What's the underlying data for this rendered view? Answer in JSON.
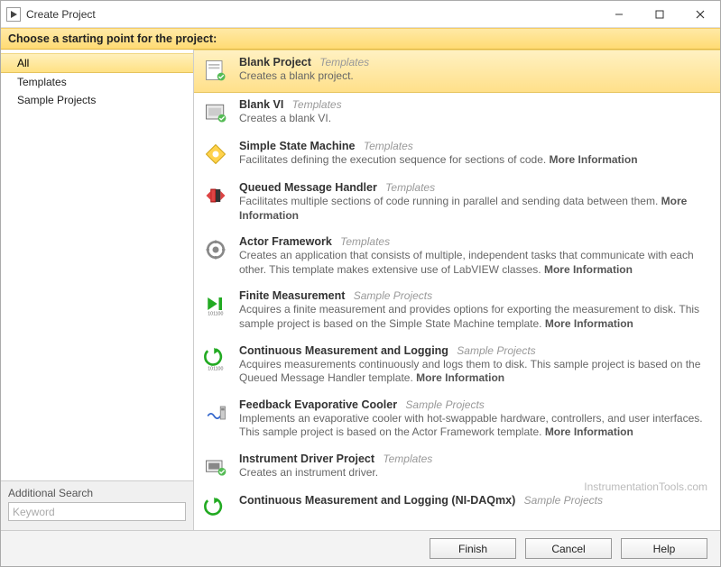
{
  "window": {
    "title": "Create Project",
    "banner": "Choose a starting point for the project:"
  },
  "categories": {
    "items": [
      {
        "label": "All",
        "selected": true
      },
      {
        "label": "Templates",
        "selected": false
      },
      {
        "label": "Sample Projects",
        "selected": false
      }
    ]
  },
  "search": {
    "label": "Additional Search",
    "placeholder": "Keyword",
    "value": ""
  },
  "templates": [
    {
      "icon": "blank-project-icon",
      "title": "Blank Project",
      "category": "Templates",
      "desc": "Creates a blank project.",
      "more": false,
      "selected": true
    },
    {
      "icon": "blank-vi-icon",
      "title": "Blank VI",
      "category": "Templates",
      "desc": "Creates a blank VI.",
      "more": false,
      "selected": false
    },
    {
      "icon": "state-machine-icon",
      "title": "Simple State Machine",
      "category": "Templates",
      "desc": "Facilitates defining the execution sequence for sections of code. ",
      "more": true,
      "selected": false
    },
    {
      "icon": "queued-handler-icon",
      "title": "Queued Message Handler",
      "category": "Templates",
      "desc": "Facilitates multiple sections of code running in parallel and sending data between them. ",
      "more": true,
      "selected": false
    },
    {
      "icon": "actor-framework-icon",
      "title": "Actor Framework",
      "category": "Templates",
      "desc": "Creates an application that consists of multiple, independent tasks that communicate with each other. This template makes extensive use of LabVIEW classes. ",
      "more": true,
      "selected": false
    },
    {
      "icon": "finite-measurement-icon",
      "title": "Finite Measurement",
      "category": "Sample Projects",
      "desc": "Acquires a finite measurement and provides options for exporting the measurement to disk. This sample project is based on the Simple State Machine template. ",
      "more": true,
      "selected": false
    },
    {
      "icon": "continuous-log-icon",
      "title": "Continuous Measurement and Logging",
      "category": "Sample Projects",
      "desc": "Acquires measurements continuously and logs them to disk. This sample project is based on the Queued Message Handler template. ",
      "more": true,
      "selected": false
    },
    {
      "icon": "evaporative-cooler-icon",
      "title": "Feedback Evaporative Cooler",
      "category": "Sample Projects",
      "desc": "Implements an evaporative cooler with hot-swappable hardware, controllers, and user interfaces. This sample project is based on the Actor Framework template. ",
      "more": true,
      "selected": false
    },
    {
      "icon": "instrument-driver-icon",
      "title": "Instrument Driver Project",
      "category": "Templates",
      "desc": "Creates an instrument driver.",
      "more": false,
      "selected": false
    },
    {
      "icon": "continuous-daq-icon",
      "title": "Continuous Measurement and Logging (NI-DAQmx)",
      "category": "Sample Projects",
      "desc": "",
      "more": false,
      "selected": false
    }
  ],
  "more_label": "More Information",
  "footer": {
    "finish": "Finish",
    "cancel": "Cancel",
    "help": "Help"
  },
  "watermark": "InstrumentationTools.com"
}
